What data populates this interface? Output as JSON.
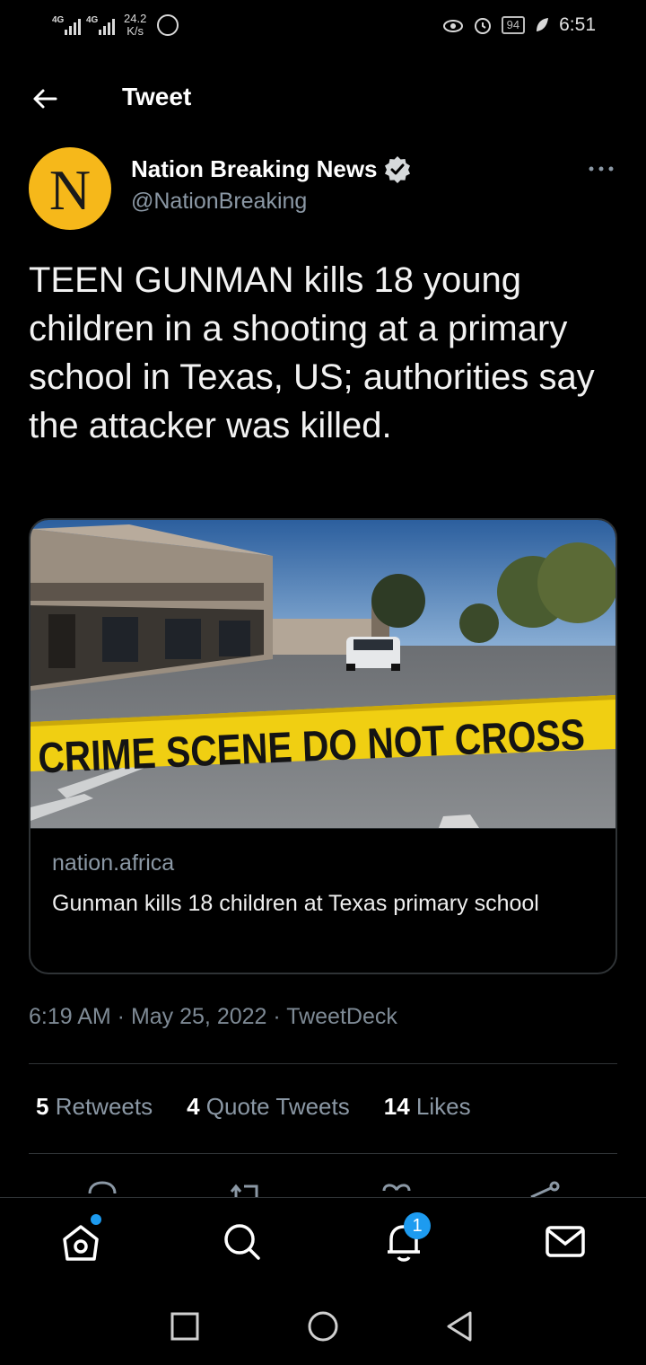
{
  "status_bar": {
    "net1": "4G",
    "net2": "4G",
    "speed_value": "24.2",
    "speed_unit": "K/s",
    "battery": "94",
    "time": "6:51"
  },
  "header": {
    "title": "Tweet"
  },
  "tweet": {
    "avatar_letter": "N",
    "author_name": "Nation Breaking News",
    "handle": "@NationBreaking",
    "text": "TEEN GUNMAN kills 18 young children in a shooting at a primary school in Texas, US; authorities say the attacker was killed.",
    "card": {
      "image_caption": "CRIME SCENE DO NOT CROSS",
      "domain": "nation.africa",
      "title": "Gunman kills 18 children at Texas primary school"
    },
    "meta": "6:19 AM · May 25, 2022 · TweetDeck",
    "stats": {
      "retweets_count": "5",
      "retweets_label": "Retweets",
      "quotes_count": "4",
      "quotes_label": "Quote Tweets",
      "likes_count": "14",
      "likes_label": "Likes"
    }
  },
  "bottom_nav": {
    "notifications_badge": "1",
    "accent": "#1d9bf0"
  },
  "icons": [
    "back-arrow-icon",
    "verified-badge-icon",
    "more-icon",
    "reply-icon",
    "retweet-icon",
    "like-icon",
    "share-icon",
    "home-icon",
    "search-icon",
    "notifications-icon",
    "messages-icon",
    "recents-icon",
    "home-circle-icon",
    "back-triangle-icon"
  ]
}
